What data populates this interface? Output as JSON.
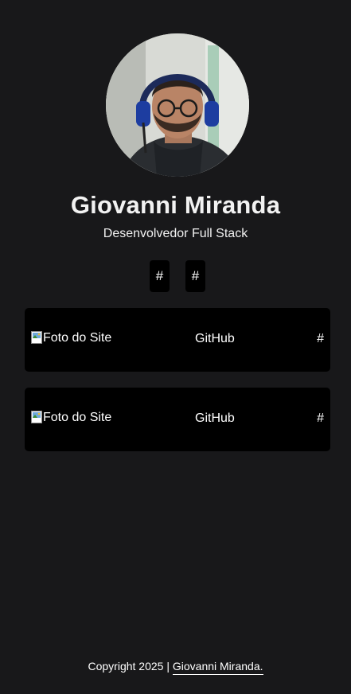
{
  "profile": {
    "name": "Giovanni Miranda",
    "role": "Desenvolvedor Full Stack",
    "avatar_alt": "Giovanni Miranda"
  },
  "socials": [
    {
      "label": "#"
    },
    {
      "label": "#"
    }
  ],
  "cards": [
    {
      "image_alt": "Foto do Site",
      "title": "GitHub",
      "link": "#"
    },
    {
      "image_alt": "Foto do Site",
      "title": "GitHub",
      "link": "#"
    }
  ],
  "footer": {
    "copyright": "Copyright 2025 | ",
    "author_link": "Giovanni Miranda."
  },
  "colors": {
    "background": "#18181a",
    "card": "#000000",
    "text": "#ffffff"
  }
}
